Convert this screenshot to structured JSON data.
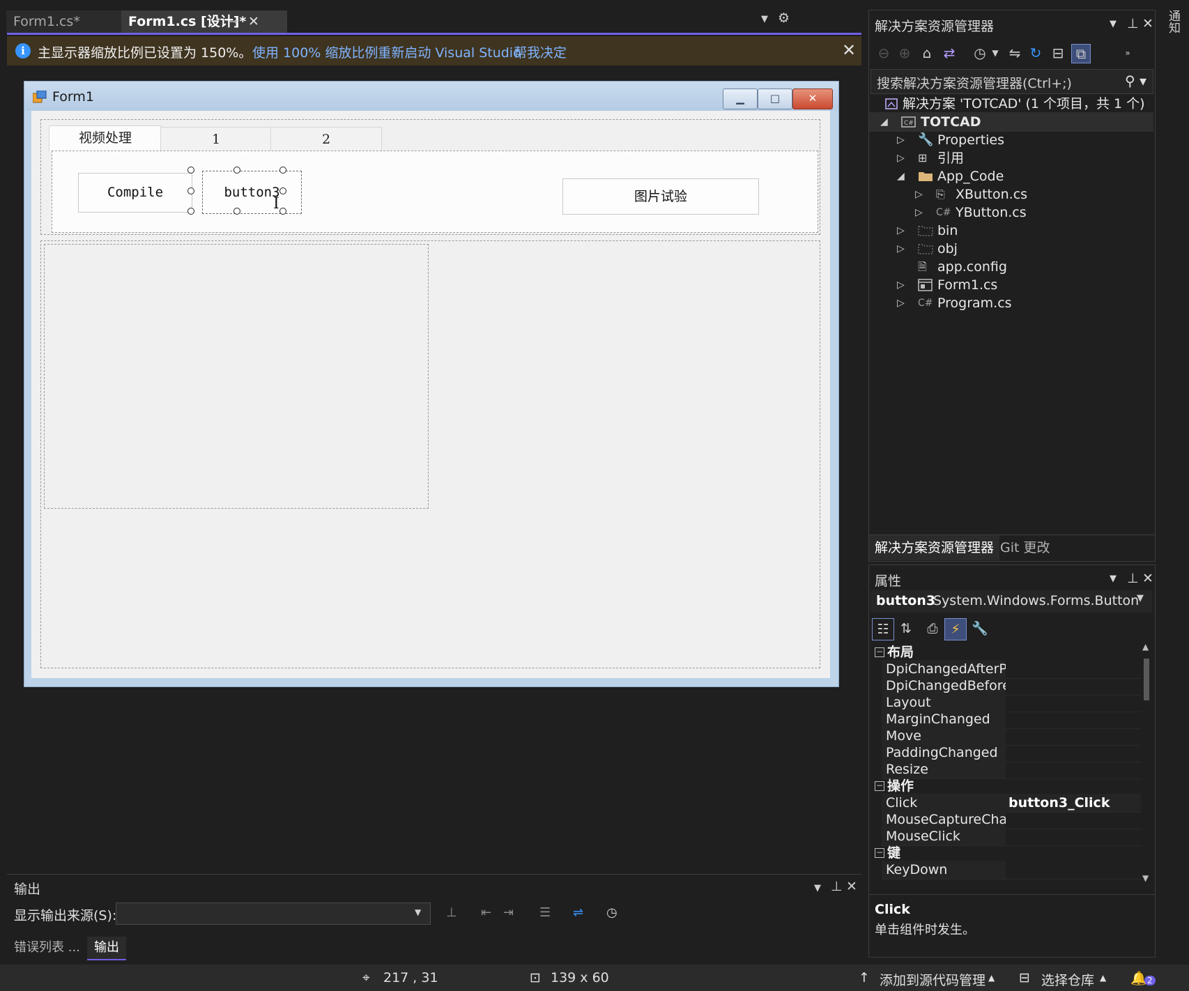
{
  "doc_tabs": [
    {
      "label": "Form1.cs*"
    },
    {
      "label": "Form1.cs [设计]*"
    }
  ],
  "infobar": {
    "message": "主显示器缩放比例已设置为 150%。",
    "link_restart": "使用 100% 缩放比例重新启动 Visual Studio",
    "link_decide": "帮我决定"
  },
  "form": {
    "title": "Form1",
    "tabs": [
      "视频处理",
      "1",
      "2"
    ],
    "buttons": {
      "compile": "Compile",
      "button3": "button3",
      "image_test": "图片试验"
    }
  },
  "solution_explorer": {
    "title": "解决方案资源管理器",
    "search_placeholder": "搜索解决方案资源管理器(Ctrl+;)",
    "tree": [
      {
        "label": "解决方案 'TOTCAD' (1 个项目，共 1 个)",
        "icon": "solution-icon"
      },
      {
        "label": "TOTCAD",
        "icon": "csharp-project-icon"
      },
      {
        "label": "Properties",
        "icon": "wrench-icon"
      },
      {
        "label": "引用",
        "icon": "references-icon"
      },
      {
        "label": "App_Code",
        "icon": "folder-icon"
      },
      {
        "label": "XButton.cs",
        "icon": "component-file-icon"
      },
      {
        "label": "YButton.cs",
        "icon": "csharp-file-icon"
      },
      {
        "label": "bin",
        "icon": "folder-dashed-icon"
      },
      {
        "label": "obj",
        "icon": "folder-dashed-icon"
      },
      {
        "label": "app.config",
        "icon": "config-file-icon"
      },
      {
        "label": "Form1.cs",
        "icon": "form-file-icon"
      },
      {
        "label": "Program.cs",
        "icon": "csharp-file-icon"
      }
    ],
    "bottom_tabs": [
      "解决方案资源管理器",
      "Git 更改"
    ]
  },
  "properties": {
    "title": "属性",
    "object_name": "button3",
    "object_type": "System.Windows.Forms.Button",
    "categories": [
      {
        "name": "布局",
        "rows": [
          {
            "name": "DpiChangedAfterParent",
            "value": ""
          },
          {
            "name": "DpiChangedBeforeParent",
            "value": ""
          },
          {
            "name": "Layout",
            "value": ""
          },
          {
            "name": "MarginChanged",
            "value": ""
          },
          {
            "name": "Move",
            "value": ""
          },
          {
            "name": "PaddingChanged",
            "value": ""
          },
          {
            "name": "Resize",
            "value": ""
          }
        ]
      },
      {
        "name": "操作",
        "rows": [
          {
            "name": "Click",
            "value": "button3_Click"
          },
          {
            "name": "MouseCaptureChanged",
            "value": ""
          },
          {
            "name": "MouseClick",
            "value": ""
          }
        ]
      },
      {
        "name": "键",
        "rows": [
          {
            "name": "KeyDown",
            "value": ""
          }
        ]
      }
    ],
    "description_title": "Click",
    "description_text": "单击组件时发生。"
  },
  "notifications_label": "通知",
  "output": {
    "title": "输出",
    "source_label": "显示输出来源(S):",
    "source_value": ""
  },
  "bottom_tabs": {
    "errors": "错误列表 ...",
    "output": "输出"
  },
  "statusbar": {
    "position": "217 , 31",
    "size": "139 x 60",
    "add_source_control": "添加到源代码管理",
    "select_repo": "选择仓库",
    "notifications_count": "2"
  },
  "colors": {
    "accent": "#7160e8",
    "link": "#7fb4ff",
    "infobar_bg": "#3f3420",
    "form_titlebar": "#bcd3ea"
  }
}
